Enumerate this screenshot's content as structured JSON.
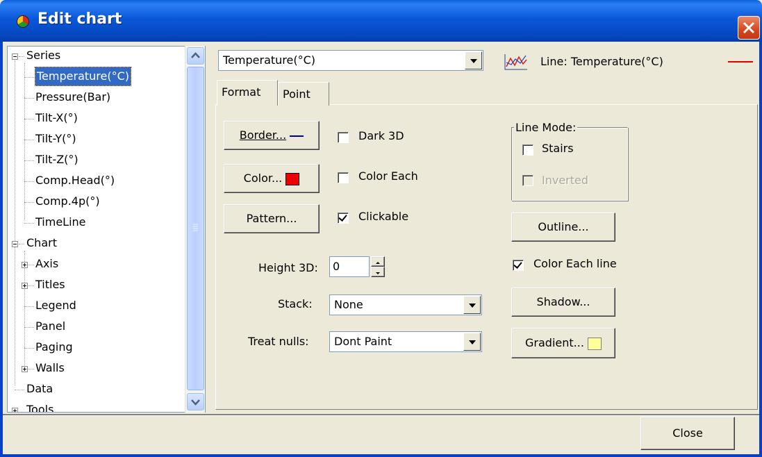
{
  "window": {
    "title": "Edit chart",
    "colors": {
      "titlebar": "#0a58d8",
      "selection": "#316ac5",
      "face": "#ece9d8"
    }
  },
  "tree": {
    "series_label": "Series",
    "series_items": [
      "Temperature(°C)",
      "Pressure(Bar)",
      "Tilt-X(°)",
      "Tilt-Y(°)",
      "Tilt-Z(°)",
      "Comp.Head(°)",
      "Comp.4p(°)",
      "TimeLine"
    ],
    "selected": "Temperature(°C)",
    "chart_label": "Chart",
    "chart_items": [
      "Axis",
      "Titles",
      "Legend",
      "Panel",
      "Paging",
      "Walls"
    ],
    "data_label": "Data",
    "tools_label": "Tools"
  },
  "series_select": {
    "value": "Temperature(°C)",
    "type_label": "Line: Temperature(°C)",
    "series_color": "#e00000"
  },
  "tabs": [
    "Format",
    "Point"
  ],
  "format": {
    "border_btn": "Border...",
    "color_btn": "Color...",
    "pattern_btn": "Pattern...",
    "color_swatch": "#ee0000",
    "dark3d": "Dark 3D",
    "color_each": "Color Each",
    "clickable": "Clickable",
    "height3d_label": "Height 3D:",
    "height3d_value": "0",
    "stack_label": "Stack:",
    "stack_value": "None",
    "nulls_label": "Treat nulls:",
    "nulls_value": "Dont Paint",
    "line_mode_title": "Line Mode:",
    "stairs": "Stairs",
    "inverted": "Inverted",
    "outline_btn": "Outline...",
    "color_each_line": "Color Each line",
    "shadow_btn": "Shadow...",
    "gradient_btn": "Gradient...",
    "gradient_swatch": "#ffff99",
    "checked": {
      "dark3d": false,
      "color_each": false,
      "clickable": true,
      "stairs": false,
      "inverted": false,
      "color_each_line": true
    }
  },
  "footer": {
    "close": "Close"
  }
}
